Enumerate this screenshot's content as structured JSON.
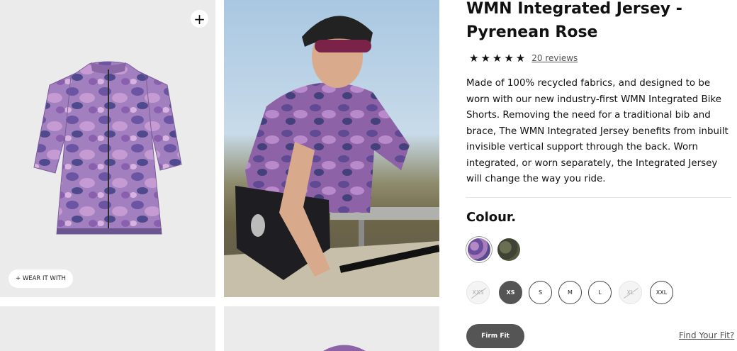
{
  "gallery": {
    "expand_icon": "plus-icon",
    "expand_label": "+",
    "wear_it_with_label": "+ WEAR IT WITH"
  },
  "product": {
    "title": "WMN Integrated Jersey - Pyrenean Rose",
    "rating": {
      "stars": 5,
      "stars_text": "★★★★★",
      "reviews_label": "20 reviews"
    },
    "description": "Made of 100% recycled fabrics, and designed to be worn with our new industry-first WMN Integrated Bike Shorts. Removing the need for a traditional bib and brace, The WMN Integrated Jersey benefits from inbuilt invisible vertical support through the back. Worn integrated, or worn separately, the Integrated Jersey will change the way you ride."
  },
  "colour": {
    "label": "Colour.",
    "swatches": [
      {
        "name": "purple-camo",
        "color": "#8a68a8",
        "selected": true
      },
      {
        "name": "olive-camo",
        "color": "#4a4e3a",
        "selected": false
      }
    ]
  },
  "sizes": [
    {
      "label": "XXS",
      "state": "unavailable"
    },
    {
      "label": "XS",
      "state": "selected"
    },
    {
      "label": "S",
      "state": "available"
    },
    {
      "label": "M",
      "state": "available"
    },
    {
      "label": "L",
      "state": "available"
    },
    {
      "label": "XL",
      "state": "unavailable"
    },
    {
      "label": "XXL",
      "state": "available"
    }
  ],
  "fit": {
    "button_label": "Firm Fit",
    "link_label": "Find Your Fit?"
  },
  "colors": {
    "dark_pill": "#555555",
    "light_panel": "#ebebeb"
  }
}
